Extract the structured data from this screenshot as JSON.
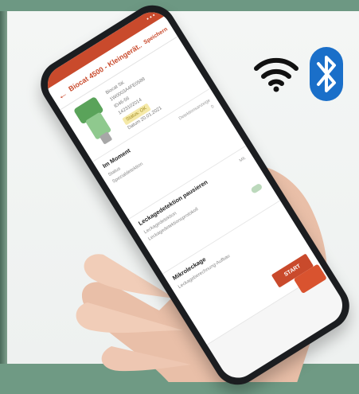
{
  "scene": {
    "background_color": "#6f9a84",
    "panel_color": "#f2f4f3",
    "accent": "#c94a2c"
  },
  "icons": {
    "wifi": "wifi-icon",
    "bluetooth": "bluetooth-icon",
    "bluetooth_color": "#1a6fc9"
  },
  "app": {
    "title": "Biocat 4500 - Kleingerät...",
    "action": "Speichern",
    "device_lines": [
      "Biocat SK",
      "1W0003A4FE0588",
      "ID46-56",
      "1423102014"
    ],
    "device_tag": "Status: OK",
    "device_date": "Datum 20.01.2021",
    "section1": {
      "title": "Im Moment",
      "rows": [
        "Status",
        "Spezialdetektion"
      ],
      "right_top": "Detektionsanzeige",
      "right_bottom": "0"
    },
    "section2": {
      "title": "Leckagedetektion pausieren",
      "rows": [
        "Leckagedetektion",
        "Leckagedetektionsprotokoll"
      ],
      "right": "Mit."
    },
    "section3": {
      "title": "Mikroleckage",
      "rows": [
        "Leckageberechnung-Aufbau"
      ]
    },
    "start_label": "START"
  }
}
